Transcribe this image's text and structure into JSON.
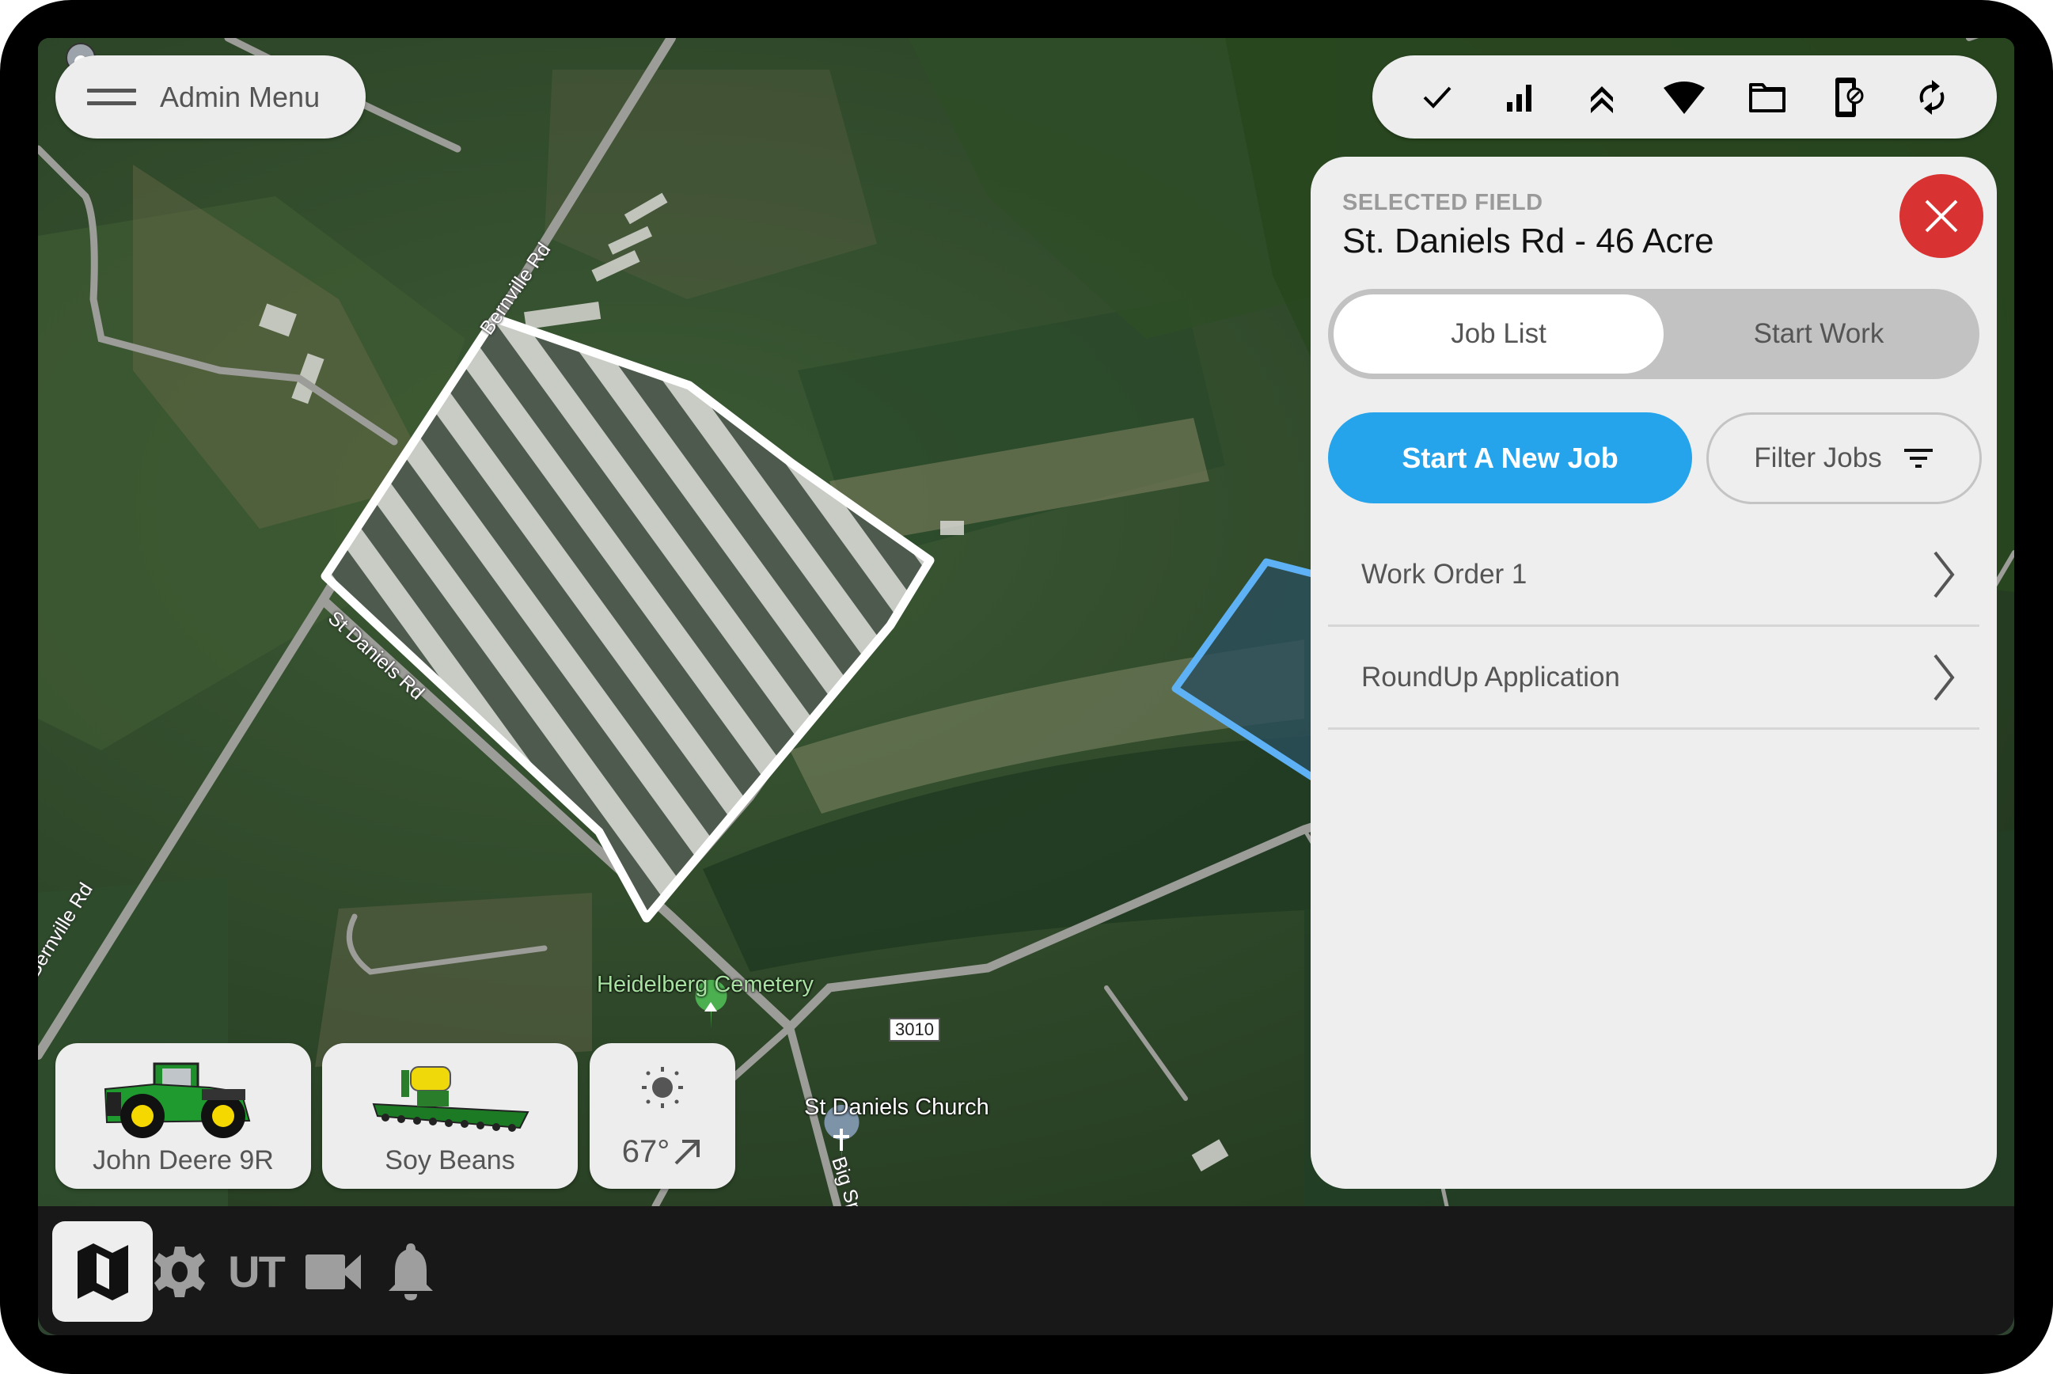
{
  "admin_menu": {
    "label": "Admin Menu",
    "icon": "hamburger-menu-icon"
  },
  "toolbar": {
    "icons": [
      {
        "name": "check-icon",
        "label": "Status OK"
      },
      {
        "name": "signal-bars-icon",
        "label": "Cellular signal"
      },
      {
        "name": "double-chevron-up-icon",
        "label": "Guidance"
      },
      {
        "name": "wifi-icon",
        "label": "Wi-Fi"
      },
      {
        "name": "folder-icon",
        "label": "Files"
      },
      {
        "name": "device-blocked-icon",
        "label": "Device"
      },
      {
        "name": "sync-icon",
        "label": "Sync"
      }
    ]
  },
  "panel": {
    "caption": "SELECTED FIELD",
    "title": "St. Daniels Rd - 46 Acre",
    "close_icon": "close-icon",
    "tabs": [
      {
        "label": "Job List",
        "active": true
      },
      {
        "label": "Start Work",
        "active": false
      }
    ],
    "new_job_label": "Start A New Job",
    "filter_label": "Filter Jobs",
    "jobs": [
      {
        "label": "Work Order 1"
      },
      {
        "label": "RoundUp Application"
      }
    ]
  },
  "cards": {
    "tractor": {
      "label": "John Deere 9R",
      "icon": "tractor-icon"
    },
    "implement": {
      "label": "Soy Beans",
      "icon": "planter-icon"
    },
    "weather": {
      "temperature": "67°",
      "icon": "sun-icon",
      "wind_icon": "arrow-up-right-icon"
    }
  },
  "bottom_nav": {
    "items": [
      {
        "name": "map",
        "icon": "map-icon",
        "active": true
      },
      {
        "name": "settings",
        "icon": "gear-icon",
        "active": false
      },
      {
        "name": "ut",
        "label": "UT",
        "active": false
      },
      {
        "name": "camera",
        "icon": "video-camera-icon",
        "active": false
      },
      {
        "name": "notifications",
        "icon": "bell-icon",
        "active": false
      }
    ]
  },
  "map": {
    "labels": {
      "bernville_rd_top": "Bernville Rd",
      "st_daniels_rd": "St Daniels Rd",
      "bernville_rd_left": "Bernville Rd",
      "cemetery": "Heidelberg Cemetery",
      "church": "St Daniels Church",
      "road_shield": "3010",
      "spring_rd": "Big Spring Rd"
    },
    "colors": {
      "selected_field_outline": "#ffffff",
      "other_field_outline": "#5eb1f5",
      "field_stripe_light": "#c8ccc5",
      "field_stripe_dark": "#4d5a4d"
    }
  },
  "colors": {
    "accent_blue": "#25a4ec",
    "close_red": "#d93233",
    "panel_bg": "#eeeeee",
    "bottom_bar": "#181818"
  }
}
